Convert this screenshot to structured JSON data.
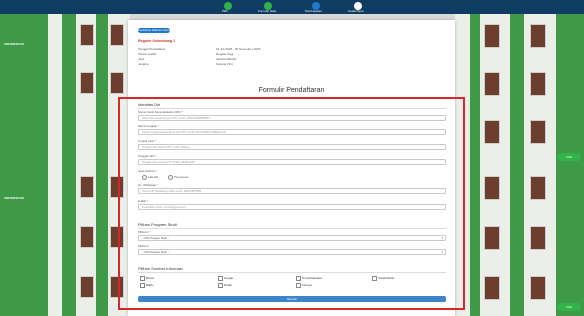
{
  "topbar": {
    "steps": [
      {
        "label": "Pilih",
        "state": "done"
      },
      {
        "label": "Formulir Data",
        "state": "done"
      },
      {
        "label": "Pembayaran",
        "state": "active"
      },
      {
        "label": "Cetak Kartu",
        "state": "pending"
      }
    ]
  },
  "card": {
    "top_button": "Kembali ke halaman utama",
    "gelombang_name": "Reguler Gelombang 1",
    "info": [
      {
        "label": "Tanggal Pendaftaran",
        "value": "01 Juli 2025 - 30 November 2025"
      },
      {
        "label": "Sistem Kuliah",
        "value": "Reguler Pagi"
      },
      {
        "label": "Jalur",
        "value": "Seleksi Mandiri"
      },
      {
        "label": "Jenjang",
        "value": "Sarjana (S1)"
      }
    ],
    "form_title": "Formulir Pendaftaran"
  },
  "form": {
    "identitas_title": "Identitas Diri",
    "nik_label": "Nomor Induk Kependudukan (NIK) *",
    "nik_placeholder": "Isikan NIK sesuai dengan KTP contoh: 3505120808060001",
    "nama_label": "Nama Lengkap *",
    "nama_placeholder": "Nama Lengkap sesuai ijazah dan KTP contoh: MUHAMMAD ABDULLAH",
    "tempat_label": "Tempat Lahir *",
    "tempat_placeholder": "Tempat Lahir sesuai KTP contoh: Malang",
    "tgl_label": "Tanggal Lahir *",
    "tgl_placeholder": "Tanggal Lahir sesuai KTP contoh: 08-08-2006",
    "jk_label": "Jenis Kelamin *",
    "jk_options": [
      "Laki-laki",
      "Perempuan"
    ],
    "wa_label": "No. WhatsApp *",
    "wa_placeholder": "Nomor HP (WhatsApp) aktif contoh: 081234567890",
    "email_label": "E-Mail *",
    "email_placeholder": "Email aktif contoh: contoh@gmail.com",
    "prodi_title": "Pilihan Program Studi",
    "pilihan1_label": "Pilihan 1 *",
    "pilihan1_value": "-- Pilih Program Studi --",
    "pilihan2_label": "Pilihan 2",
    "pilihan2_value": "-- Pilih Program Studi --",
    "sumber_title": "Pilihan Sumber Informasi",
    "sumber_options": [
      "Brosur",
      "Google",
      "Teman/Saudara",
      "Sosial Media",
      "Baliho",
      "Media",
      "Lainnya"
    ],
    "submit_label": "Simpan"
  },
  "whatsapp": {
    "label": "Chat"
  },
  "sign": {
    "left_text": "UNIVERSITAS"
  }
}
